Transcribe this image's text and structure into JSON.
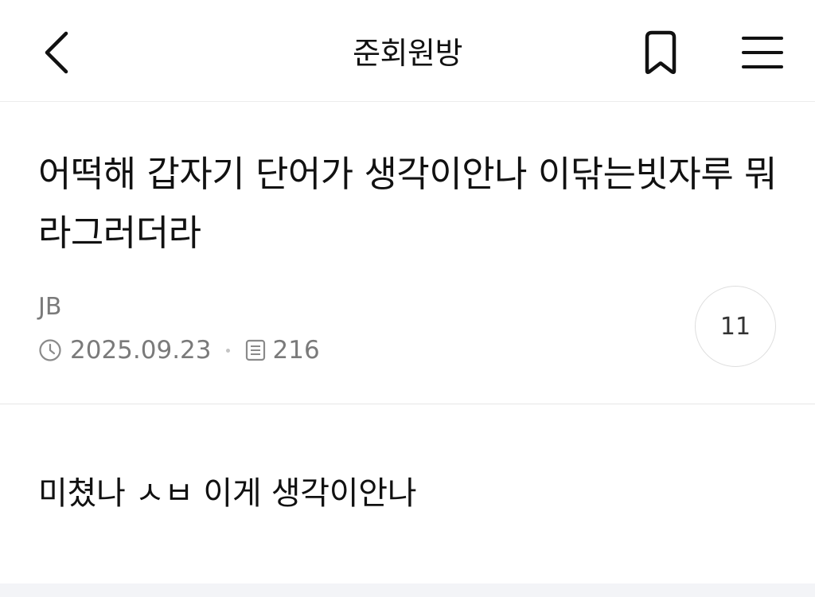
{
  "header": {
    "title": "준회원방",
    "back_icon": "chevron-left-icon",
    "bookmark_icon": "bookmark-icon",
    "menu_icon": "hamburger-menu-icon"
  },
  "post": {
    "title": "어떡해 갑자기 단어가 생각이안나 이닦는빗자루 뭐라그러더라",
    "author": "JB",
    "date": "2025.09.23",
    "views": "216",
    "comment_count": "11",
    "body": "미쳤나 ㅅㅂ 이게 생각이안나"
  },
  "colors": {
    "text": "#111111",
    "meta": "#7a7a7a",
    "divider": "#e6e6e6",
    "bottom_band": "#f3f4f7"
  }
}
